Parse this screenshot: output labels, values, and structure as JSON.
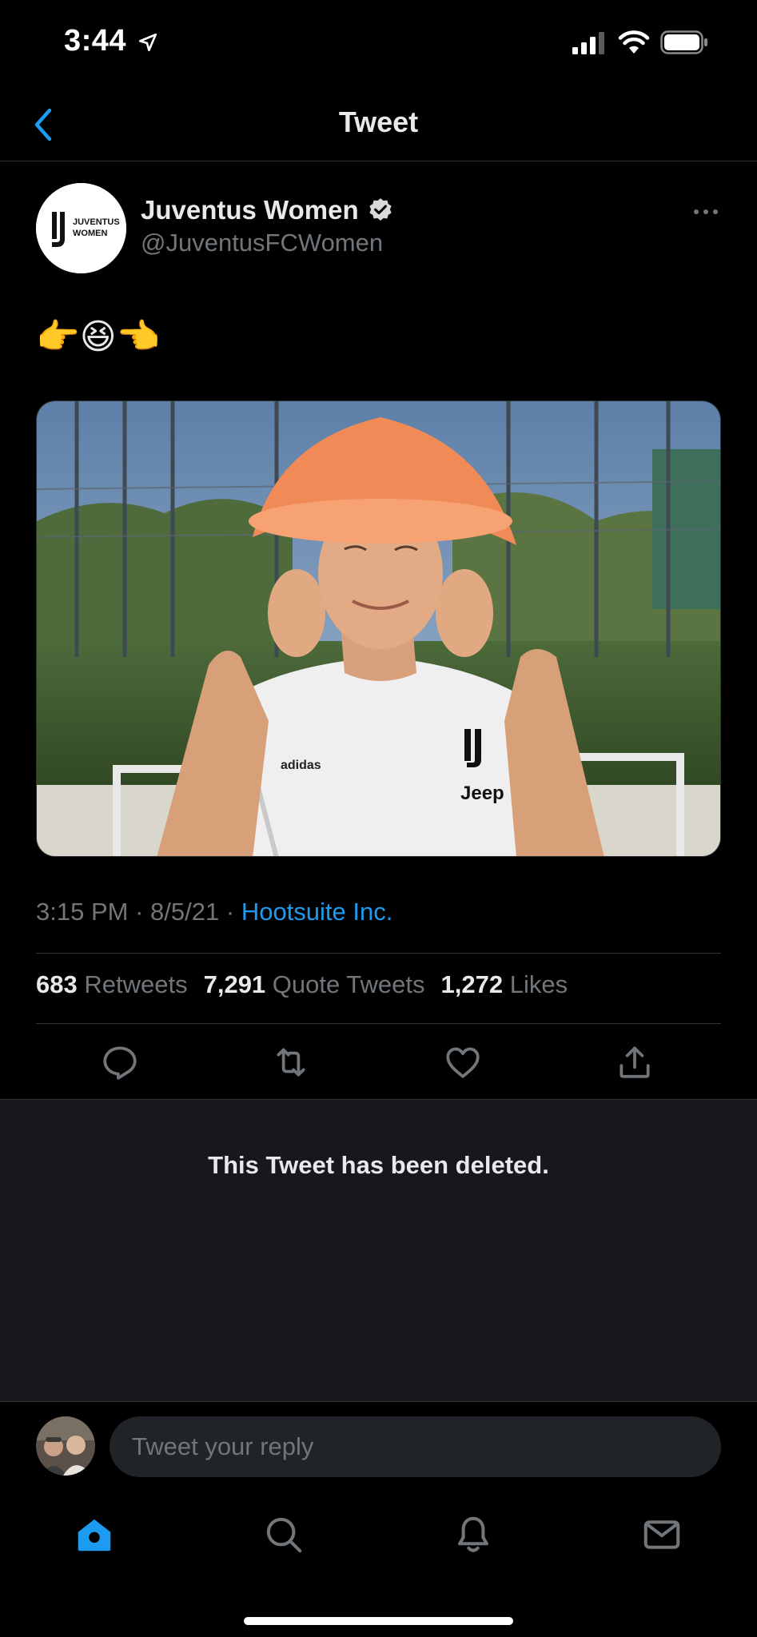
{
  "status_bar": {
    "time": "3:44"
  },
  "header": {
    "title": "Tweet"
  },
  "tweet": {
    "author_name": "Juventus Women",
    "author_handle": "@JuventusFCWomen",
    "avatar_logo_text": [
      "JUVENTUS",
      "WOMEN"
    ],
    "text": "👉😆👈",
    "time": "3:15 PM",
    "date": "8/5/21",
    "separator": "·",
    "source": "Hootsuite Inc.",
    "retweets_count": "683",
    "retweets_label": "Retweets",
    "quote_count": "7,291",
    "quote_label": "Quote Tweets",
    "likes_count": "1,272",
    "likes_label": "Likes",
    "media_jersey_text": [
      "adidas",
      "Jeep"
    ]
  },
  "deleted": {
    "message": "This Tweet has been deleted."
  },
  "reply": {
    "placeholder": "Tweet your reply"
  },
  "colors": {
    "accent": "#1d9bf0",
    "background": "#000000",
    "muted": "#71767b"
  },
  "icons": [
    "back-chevron-icon",
    "verified-badge-icon",
    "more-dots-icon",
    "reply-icon",
    "retweet-icon",
    "like-icon",
    "share-icon",
    "home-icon",
    "search-icon",
    "bell-icon",
    "mail-icon"
  ]
}
